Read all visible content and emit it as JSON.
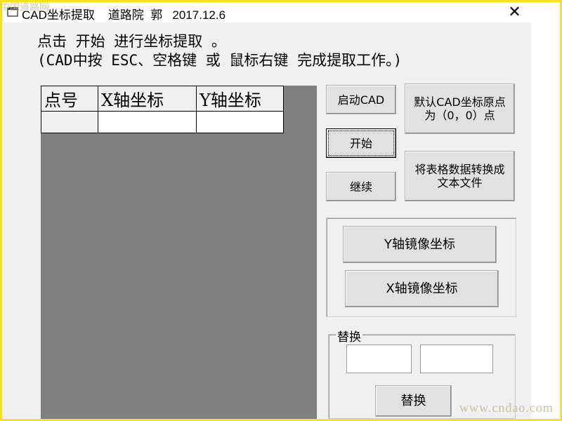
{
  "window": {
    "title": "CAD坐标提取    道路院  郭   2017.12.6",
    "close_symbol": "✕"
  },
  "instructions": {
    "line1": "点击 开始 进行坐标提取 。",
    "line2": "(CAD中按 ESC、空格键 或 鼠标右键 完成提取工作。)"
  },
  "grid": {
    "columns": [
      "点号",
      "X轴坐标",
      "Y轴坐标"
    ],
    "rows": [
      [
        "",
        "",
        ""
      ]
    ]
  },
  "buttons": {
    "start_cad": "启动CAD",
    "start": "开始",
    "continue": "继续",
    "default_origin": "默认CAD坐标原点为（0，0）点",
    "export_text": "将表格数据转换成文本文件",
    "y_mirror": "Y轴镜像坐标",
    "x_mirror": "X轴镜像坐标"
  },
  "replace_group": {
    "label": "替换",
    "find_value": "",
    "replace_value": "",
    "button": "替换"
  },
  "watermarks": {
    "top_left": "中国道路网",
    "bottom_right": "www.cndao.com"
  },
  "colors": {
    "frame": "#f5e21c",
    "grid_background": "#808080",
    "window_background": "#f0f0f0"
  },
  "icons": {
    "app": "window-icon",
    "close": "close-icon"
  }
}
